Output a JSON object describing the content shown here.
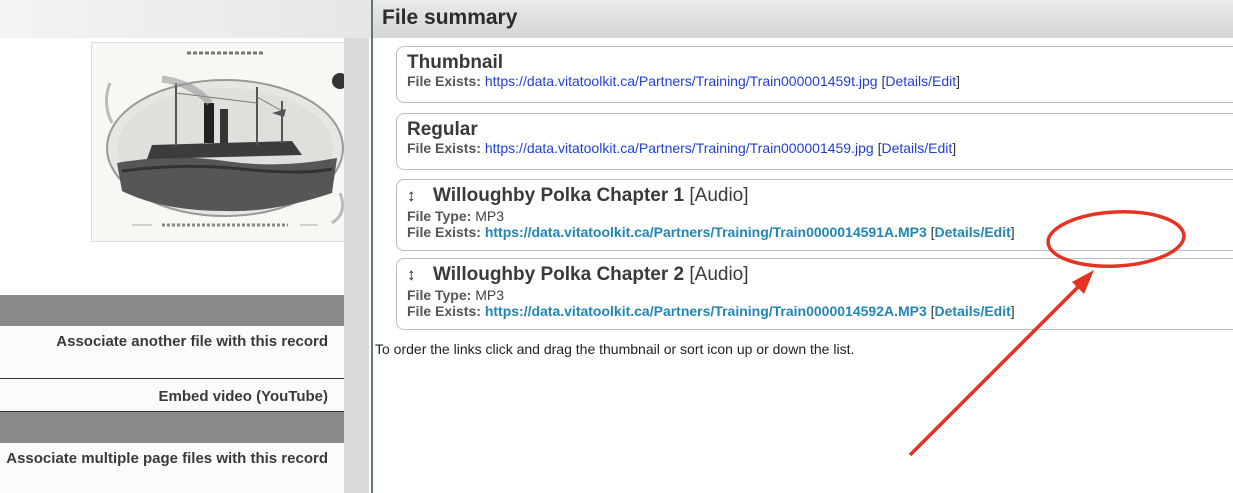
{
  "header": {
    "title": "File summary"
  },
  "sidebar": {
    "items": [
      {
        "label": "Associate another file with this record"
      },
      {
        "label": "Embed video (YouTube)"
      },
      {
        "label": "Associate multiple page files with this record"
      }
    ]
  },
  "files": [
    {
      "title": "Thumbnail",
      "exists_label": "File Exists:",
      "url": "https://data.vitatoolkit.ca/Partners/Training/Train000001459t.jpg",
      "edit_label": "Details/Edit"
    },
    {
      "title": "Regular",
      "exists_label": "File Exists:",
      "url": "https://data.vitatoolkit.ca/Partners/Training/Train000001459.jpg",
      "edit_label": "Details/Edit"
    },
    {
      "title": "Willoughby Polka Chapter 1",
      "kind": "[Audio]",
      "type_label": "File Type:",
      "type": "MP3",
      "exists_label": "File Exists:",
      "url": "https://data.vitatoolkit.ca/Partners/Training/Train0000014591A.MP3",
      "edit_label": "Details/Edit"
    },
    {
      "title": "Willoughby Polka Chapter 2",
      "kind": "[Audio]",
      "type_label": "File Type:",
      "type": "MP3",
      "exists_label": "File Exists:",
      "url": "https://data.vitatoolkit.ca/Partners/Training/Train0000014592A.MP3",
      "edit_label": "Details/Edit"
    }
  ],
  "hint": "To order the links click and drag the thumbnail or sort icon up or down the list.",
  "icons": {
    "sort": "sort-arrows-icon"
  },
  "colors": {
    "link": "#1f3fd8",
    "link_alt": "#1f86b5",
    "annotation": "#e53222",
    "divider": "#5d7c62"
  }
}
